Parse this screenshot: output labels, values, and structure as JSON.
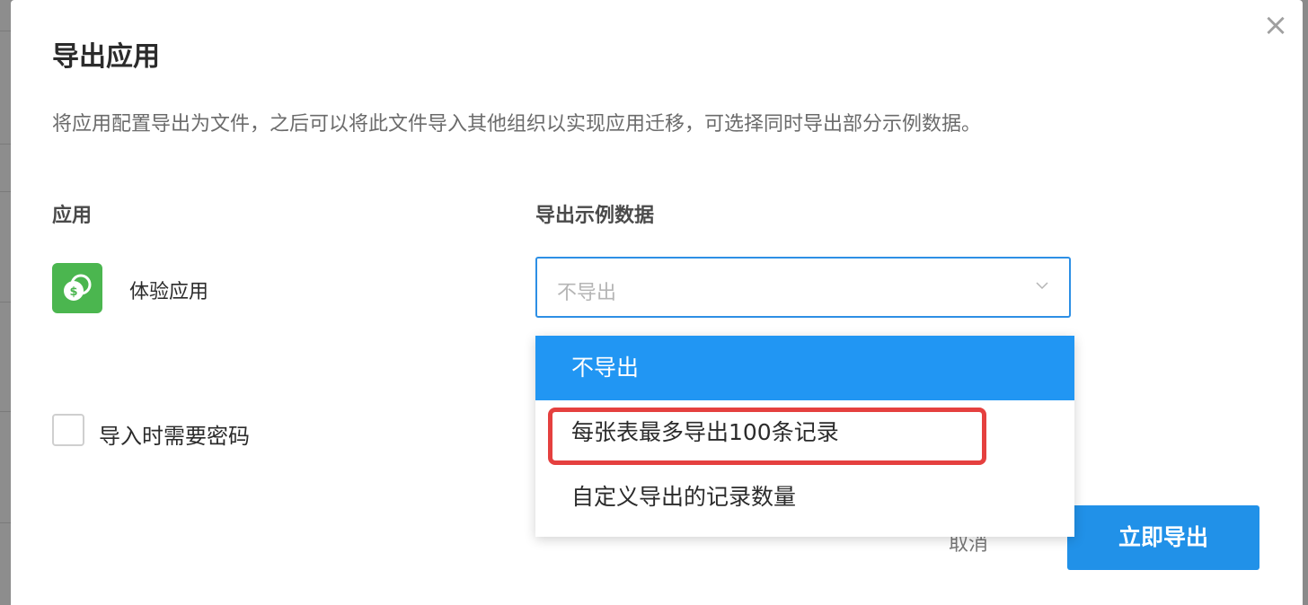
{
  "dialog": {
    "title": "导出应用",
    "description": "将应用配置导出为文件，之后可以将此文件导入其他组织以实现应用迁移，可选择同时导出部分示例数据。",
    "close_icon": "close-icon"
  },
  "app_section": {
    "label": "应用",
    "app_name": "体验应用",
    "app_icon": "money-icon",
    "icon_color": "#4bb64f"
  },
  "sample_section": {
    "label": "导出示例数据",
    "selected_value": "不导出",
    "options": [
      {
        "label": "不导出",
        "selected": true
      },
      {
        "label": "每张表最多导出100条记录",
        "selected": false,
        "highlighted": true
      },
      {
        "label": "自定义导出的记录数量",
        "selected": false
      }
    ]
  },
  "password_checkbox": {
    "label": "导入时需要密码",
    "checked": false
  },
  "footer": {
    "cancel_label": "取消",
    "export_label": "立即导出"
  },
  "colors": {
    "accent": "#2196f3",
    "primary_button": "#2191e8",
    "highlight": "#e5403f"
  }
}
